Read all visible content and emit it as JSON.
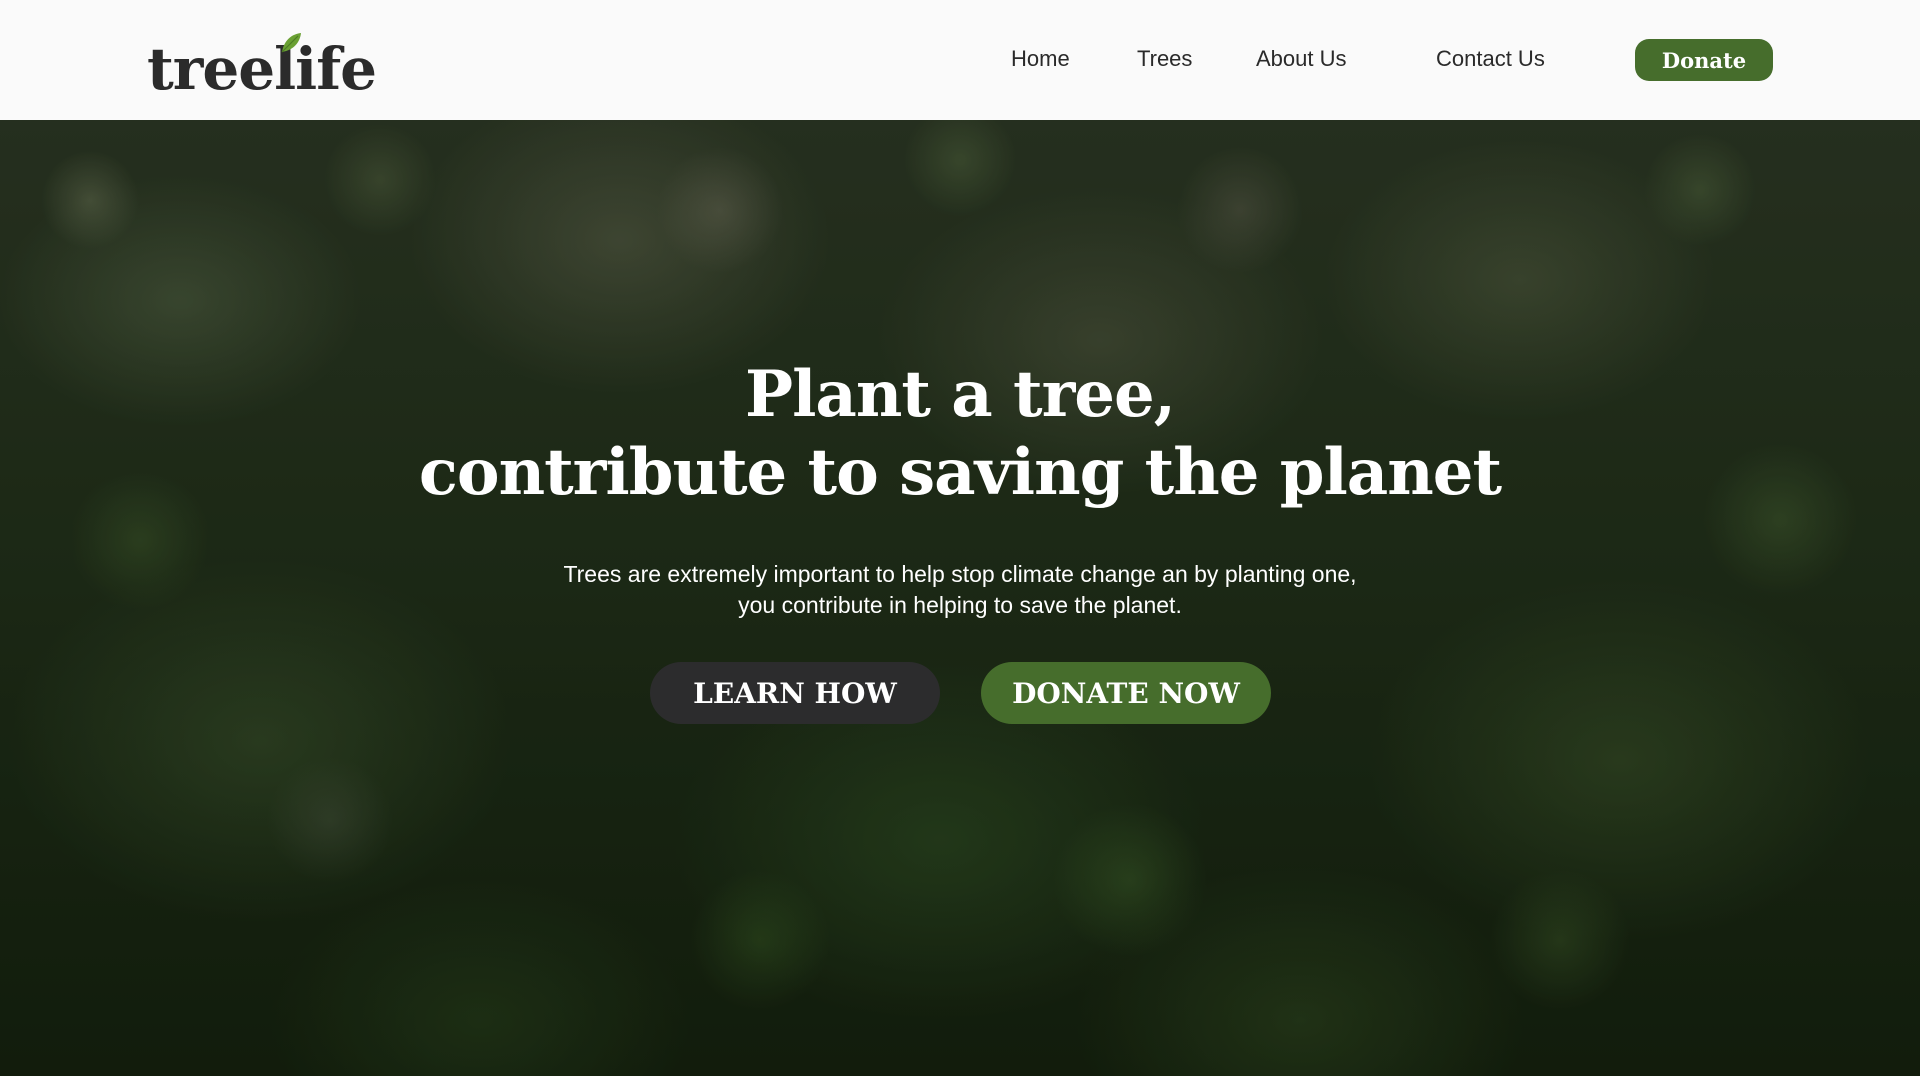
{
  "header": {
    "logo_text": "treelife",
    "nav": {
      "home": "Home",
      "trees": "Trees",
      "about": "About Us",
      "contact": "Contact Us"
    },
    "donate_label": "Donate"
  },
  "hero": {
    "title_line1": "Plant a tree,",
    "title_line2": "contribute to saving the planet",
    "text_line1": "Trees are extremely important to help stop climate change an by planting one,",
    "text_line2": "you contribute in helping to save the planet.",
    "learn_label": "LEARN HOW",
    "donate_now_label": "DONATE NOW"
  },
  "colors": {
    "brand_green": "#466d2c",
    "dark_button": "#2c2c2d",
    "leaf_green": "#6aa033"
  },
  "icons": {
    "logo_leaf": "leaf-icon"
  }
}
